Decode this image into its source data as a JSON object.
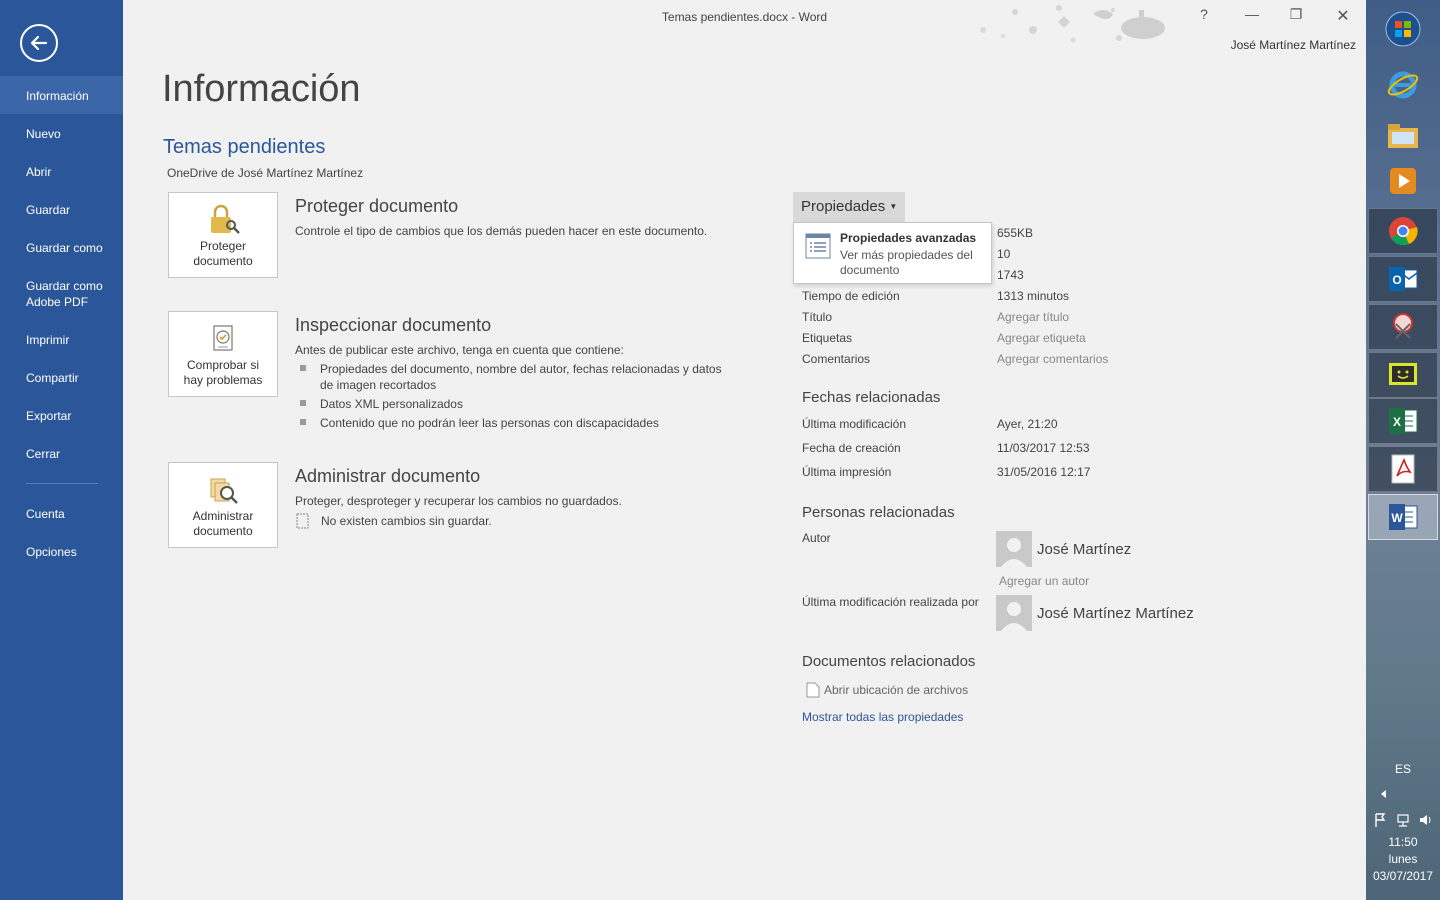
{
  "window": {
    "title": "Temas pendientes.docx - Word",
    "user": "José Martínez Martínez",
    "help": "?",
    "minimize": "—",
    "restore": "❐",
    "close": "✕"
  },
  "sidebar": {
    "items": [
      {
        "label": "Información",
        "active": true
      },
      {
        "label": "Nuevo"
      },
      {
        "label": "Abrir"
      },
      {
        "label": "Guardar"
      },
      {
        "label": "Guardar como"
      },
      {
        "label": "Guardar como Adobe PDF"
      },
      {
        "label": "Imprimir"
      },
      {
        "label": "Compartir"
      },
      {
        "label": "Exportar"
      },
      {
        "label": "Cerrar"
      },
      {
        "label": "Cuenta"
      },
      {
        "label": "Opciones"
      }
    ]
  },
  "main": {
    "title": "Información",
    "doc_name": "Temas pendientes",
    "location": "OneDrive de José Martínez Martínez",
    "protect": {
      "button": "Proteger documento",
      "heading": "Proteger documento",
      "desc": "Controle el tipo de cambios que los demás pueden hacer en este documento."
    },
    "inspect": {
      "button": "Comprobar si hay problemas",
      "heading": "Inspeccionar documento",
      "desc": "Antes de publicar este archivo, tenga en cuenta que contiene:",
      "bullets": [
        "Propiedades del documento, nombre del autor, fechas relacionadas y datos de imagen recortados",
        "Datos XML personalizados",
        "Contenido que no podrán leer las personas con discapacidades"
      ]
    },
    "manage": {
      "button": "Administrar documento",
      "heading": "Administrar documento",
      "desc": "Proteger, desproteger y recuperar los cambios no guardados.",
      "status": "No existen cambios sin guardar."
    }
  },
  "properties": {
    "button": "Propiedades",
    "dropdown": {
      "title": "Propiedades avanzadas",
      "subtitle": "Ver más propiedades del documento"
    },
    "values_top": [
      "655KB",
      "10",
      "1743"
    ],
    "rows": [
      {
        "label": "Tiempo de edición",
        "value": "1313 minutos"
      },
      {
        "label": "Título",
        "value": "Agregar título"
      },
      {
        "label": "Etiquetas",
        "value": "Agregar etiqueta"
      },
      {
        "label": "Comentarios",
        "value": "Agregar comentarios"
      }
    ],
    "dates_heading": "Fechas relacionadas",
    "dates": [
      {
        "label": "Última modificación",
        "value": "Ayer, 21:20"
      },
      {
        "label": "Fecha de creación",
        "value": "11/03/2017 12:53"
      },
      {
        "label": "Última impresión",
        "value": "31/05/2016 12:17"
      }
    ],
    "people_heading": "Personas relacionadas",
    "author_label": "Autor",
    "author_name": "José Martínez",
    "add_author": "Agregar un autor",
    "last_modified_label": "Última modificación realizada por",
    "last_modified_name": "José Martínez Martínez",
    "docs_heading": "Documentos relacionados",
    "open_location": "Abrir ubicación de archivos",
    "show_all": "Mostrar todas las propiedades"
  },
  "taskbar": {
    "lang": "ES",
    "time": "11:50",
    "day": "lunes",
    "date": "03/07/2017",
    "icons": [
      "windows-start-icon",
      "internet-explorer-icon",
      "file-explorer-icon",
      "media-player-icon",
      "chrome-icon",
      "outlook-icon",
      "snipping-tool-icon",
      "app-icon",
      "excel-icon",
      "acrobat-icon",
      "word-icon"
    ]
  },
  "colors": {
    "accent": "#2b579a",
    "background": "#f1f1f1"
  }
}
